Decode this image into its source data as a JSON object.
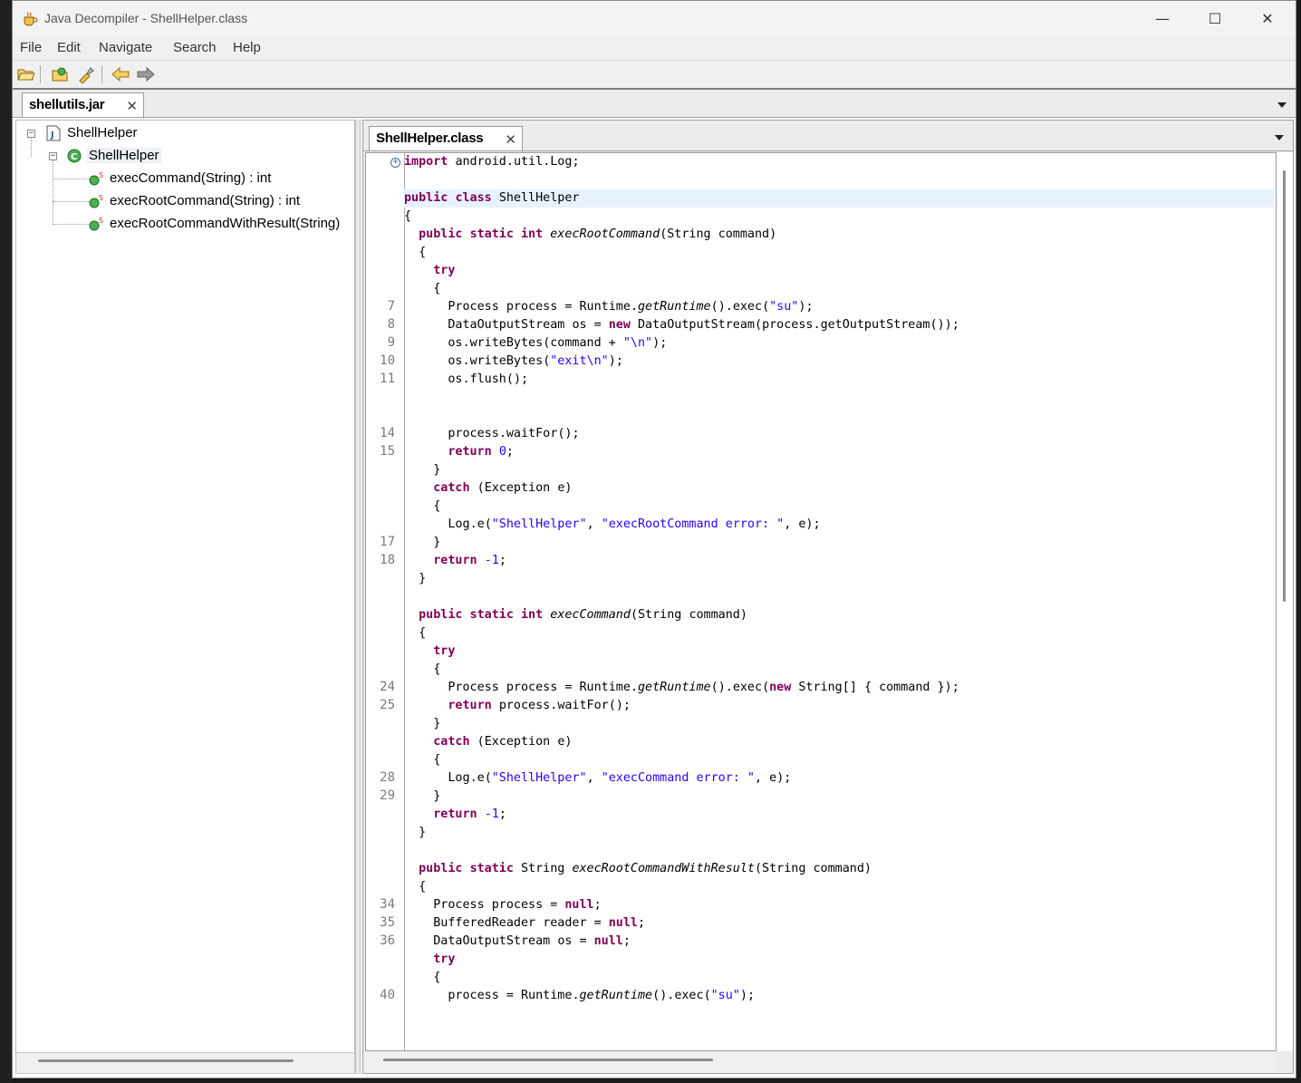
{
  "window": {
    "title": "Java Decompiler - ShellHelper.class",
    "controls": {
      "minimize": "—",
      "maximize": "☐",
      "close": "✕"
    }
  },
  "menu": [
    "File",
    "Edit",
    "Navigate",
    "Search",
    "Help"
  ],
  "toolbar": {
    "icons": [
      "open-file-icon",
      "open-type-icon",
      "search-icon",
      "back-icon",
      "forward-icon"
    ]
  },
  "jar_tab": {
    "label": "shellutils.jar",
    "close": "✕"
  },
  "tree": {
    "root": "ShellHelper",
    "class": "ShellHelper",
    "methods": [
      {
        "label": "execCommand(String) : int"
      },
      {
        "label": "execRootCommand(String) : int"
      },
      {
        "label": "execRootCommandWithResult(String)"
      }
    ]
  },
  "class_tab": {
    "label": "ShellHelper.class",
    "close": "✕"
  },
  "code": {
    "line_numbers": [
      "7",
      "8",
      "9",
      "10",
      "11",
      "14",
      "15",
      "17",
      "18",
      "24",
      "25",
      "28",
      "29",
      "34",
      "35",
      "36",
      "40"
    ],
    "fold_marker": "+",
    "lines": [
      "import android.util.Log;",
      "public class ShellHelper",
      "{",
      "  public static int execRootCommand(String command)",
      "  {",
      "    try",
      "    {",
      "      Process process = Runtime.getRuntime().exec(\"su\");",
      "      DataOutputStream os = new DataOutputStream(process.getOutputStream());",
      "      os.writeBytes(command + \"\\n\");",
      "      os.writeBytes(\"exit\\n\");",
      "      os.flush();",
      "      process.waitFor();",
      "      return 0;",
      "    }",
      "    catch (Exception e)",
      "    {",
      "      Log.e(\"ShellHelper\", \"execRootCommand error: \", e);",
      "    }",
      "    return -1;",
      "  }",
      "  public static int execCommand(String command)",
      "  {",
      "    try",
      "    {",
      "      Process process = Runtime.getRuntime().exec(new String[] { command });",
      "      return process.waitFor();",
      "    }",
      "    catch (Exception e)",
      "    {",
      "      Log.e(\"ShellHelper\", \"execCommand error: \", e);",
      "    }",
      "    return -1;",
      "  }",
      "  public static String execRootCommandWithResult(String command)",
      "  {",
      "    Process process = null;",
      "    BufferedReader reader = null;",
      "    DataOutputStream os = null;",
      "    try",
      "    {",
      "      process = Runtime.getRuntime().exec(\"su\");"
    ]
  },
  "colors": {
    "keyword": "#7f0055",
    "string": "#2a00ff",
    "highlight": "#e8f2fe"
  }
}
